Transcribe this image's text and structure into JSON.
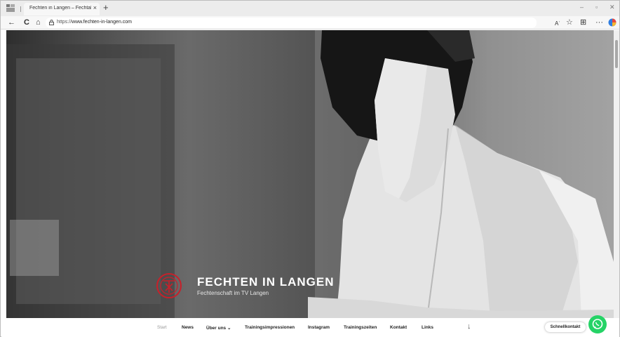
{
  "browser": {
    "tab_title": "Fechten in Langen – Fechtabteil",
    "tab_close": "×",
    "new_tab": "+",
    "url_protocol": "https://",
    "url_host": "www.fechten-in-langen.com",
    "window_controls": {
      "minimize": "–",
      "maximize": "▫",
      "close": "✕"
    },
    "toolbar": {
      "back": "←",
      "reload": "C",
      "home": "⌂",
      "read_aloud": "Aʾ",
      "favorite": "☆",
      "collections": "⊞",
      "more": "···"
    }
  },
  "hero": {
    "title": "FECHTEN IN LANGEN",
    "subtitle": "Fechtenschaft im TV Langen"
  },
  "nav": {
    "items": [
      {
        "label": "Start",
        "active": true
      },
      {
        "label": "News"
      },
      {
        "label": "Über uns ⌄"
      },
      {
        "label": "Trainingsimpressionen"
      },
      {
        "label": "Instagram"
      },
      {
        "label": "Trainingszeiten"
      },
      {
        "label": "Kontakt"
      },
      {
        "label": "Links"
      }
    ],
    "scroll_down": "↓",
    "quick_contact": "Schnellkontakt"
  },
  "colors": {
    "accent": "#c8202a",
    "whatsapp": "#25d366"
  }
}
